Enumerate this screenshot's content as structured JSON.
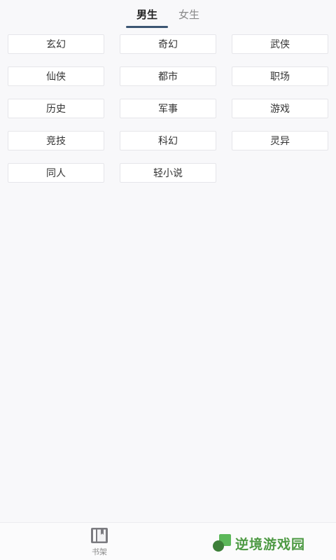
{
  "tabs": [
    {
      "label": "男生",
      "active": true
    },
    {
      "label": "女生",
      "active": false
    }
  ],
  "categories": [
    "玄幻",
    "奇幻",
    "武侠",
    "仙侠",
    "都市",
    "职场",
    "历史",
    "军事",
    "游戏",
    "竞技",
    "科幻",
    "灵异",
    "同人",
    "轻小说"
  ],
  "bottom_nav": {
    "bookshelf_label": "书架",
    "bookshelf_icon": "bookshelf-icon"
  },
  "watermark": {
    "text": "逆境游戏园",
    "logo_icon": "green-logo-icon"
  },
  "colors": {
    "active_tab_underline": "#3b5573",
    "watermark_green": "#4e9a44"
  }
}
